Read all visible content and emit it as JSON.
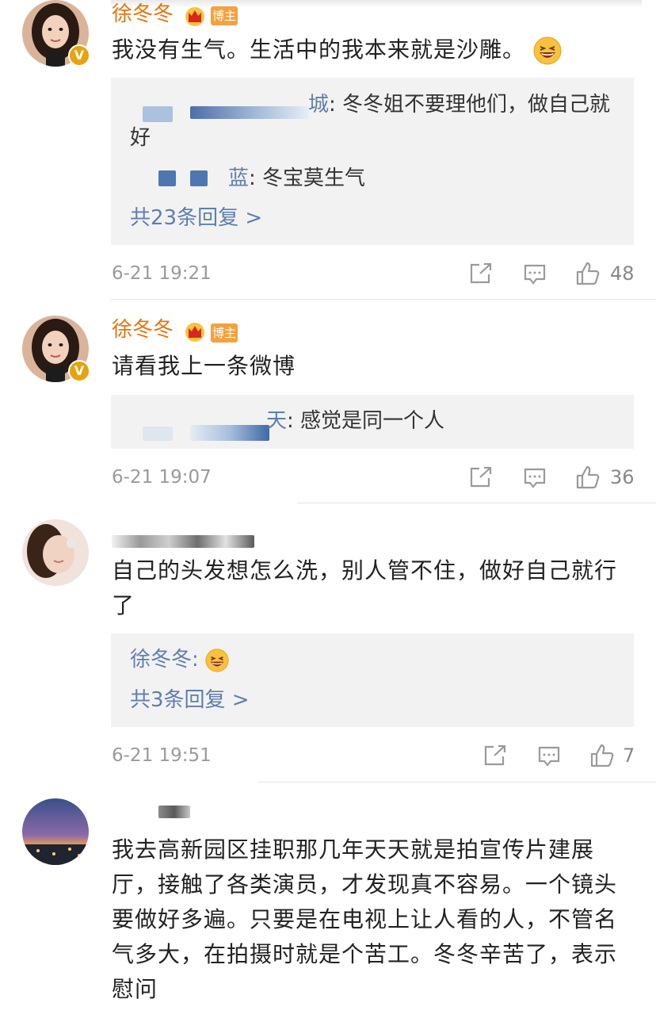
{
  "comments": [
    {
      "username": "徐冬冬",
      "badge": "博主",
      "verified": "V",
      "text": "我没有生气。生活中的我本来就是沙雕。",
      "replies": [
        {
          "name_visible": "城",
          "text": ": 冬冬姐不要理他们，做自己就好"
        },
        {
          "name_visible": "蓝",
          "text": ": 冬宝莫生气"
        }
      ],
      "more": "共23条回复 >",
      "time": "6-21 19:21",
      "likes": "48"
    },
    {
      "username": "徐冬冬",
      "badge": "博主",
      "verified": "V",
      "text": "请看我上一条微博",
      "replies": [
        {
          "name_visible": "天",
          "text": ": 感觉是同一个人"
        }
      ],
      "time": "6-21 19:07",
      "likes": "36"
    },
    {
      "text": "自己的头发想怎么洗，别人管不住，做好自己就行了",
      "replies": [
        {
          "name_visible": "徐冬冬",
          "text": ":"
        }
      ],
      "more": "共3条回复 >",
      "time": "6-21 19:51",
      "likes": "7"
    },
    {
      "text": "我去高新园区挂职那几年天天就是拍宣传片建展厅，接触了各类演员，才发现真不容易。一个镜头要做好多遍。只要是在电视上让人看的人，不管名气多大，在拍摄时就是个苦工。冬冬辛苦了，表示慰问"
    }
  ],
  "colors": {
    "username": "#e8730a",
    "reply_name": "#5f7fae",
    "reply_bg": "#f2f2f2",
    "meta": "#9a9a9a"
  },
  "icons": [
    "share-icon",
    "comment-icon",
    "like-icon",
    "crown-icon",
    "laughing-emoji-icon"
  ]
}
